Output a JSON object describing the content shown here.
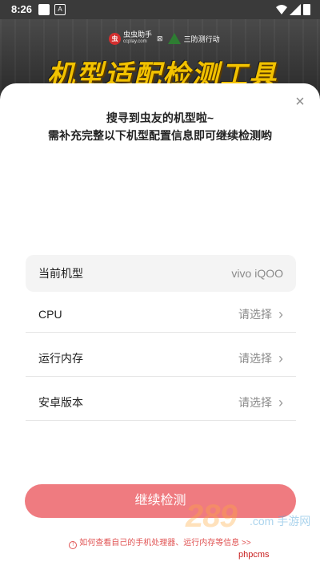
{
  "status_bar": {
    "time": "8:26",
    "notif_icons": [
      "square-icon",
      "a-icon"
    ],
    "system_icons": [
      "wifi-icon",
      "signal-icon",
      "battery-icon"
    ]
  },
  "banner": {
    "brand_name": "虫虫助手",
    "brand_url": "ccplay.com",
    "brand_logo_text": "虫",
    "cross": "⊠",
    "brand2_name": "三防测行动",
    "title": "机型适配检测工具"
  },
  "dialog": {
    "close_symbol": "×",
    "headline_line1": "搜寻到虫友的机型啦~",
    "headline_line2": "需补充完整以下机型配置信息即可继续检测哟",
    "rows": [
      {
        "label": "当前机型",
        "value": "vivo iQOO"
      },
      {
        "label": "CPU",
        "value": "请选择"
      },
      {
        "label": "运行内存",
        "value": "请选择"
      },
      {
        "label": "安卓版本",
        "value": "请选择"
      }
    ],
    "chevron": "›",
    "submit_label": "继续检测",
    "help_icon": "!",
    "help_text": "如何查看自己的手机处理器、运行内存等信息 >>"
  },
  "watermarks": {
    "wm1": "289",
    "wm2": ".com 手游网",
    "wm3": "phpcms"
  },
  "colors": {
    "accent": "#ef7b80",
    "link_red": "#e05353",
    "banner_title": "#f2c200"
  }
}
